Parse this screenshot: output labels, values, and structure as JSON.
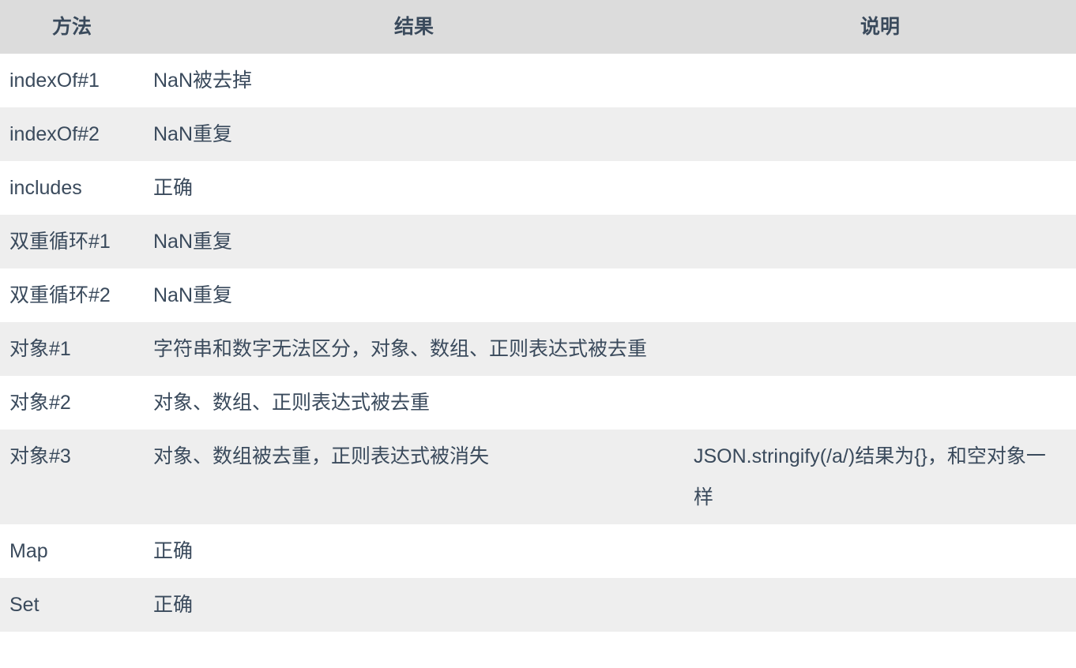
{
  "table": {
    "columns": [
      {
        "key": "method",
        "label": "方法"
      },
      {
        "key": "result",
        "label": "结果"
      },
      {
        "key": "note",
        "label": "说明"
      }
    ],
    "rows": [
      {
        "method": "indexOf#1",
        "result": "NaN被去掉",
        "note": ""
      },
      {
        "method": "indexOf#2",
        "result": "NaN重复",
        "note": ""
      },
      {
        "method": "includes",
        "result": "正确",
        "note": ""
      },
      {
        "method": "双重循环#1",
        "result": "NaN重复",
        "note": ""
      },
      {
        "method": "双重循环#2",
        "result": "NaN重复",
        "note": ""
      },
      {
        "method": "对象#1",
        "result": "字符串和数字无法区分，对象、数组、正则表达式被去重",
        "note": ""
      },
      {
        "method": "对象#2",
        "result": "对象、数组、正则表达式被去重",
        "note": ""
      },
      {
        "method": "对象#3",
        "result": "对象、数组被去重，正则表达式被消失",
        "note": "JSON.stringify(/a/)结果为{}，和空对象一样"
      },
      {
        "method": "Map",
        "result": "正确",
        "note": ""
      },
      {
        "method": "Set",
        "result": "正确",
        "note": ""
      }
    ]
  },
  "colors": {
    "header_background": "#dcdcdc",
    "row_band_light": "#eeeeee",
    "row_band_white": "#ffffff",
    "text": "#3a4a5c"
  }
}
